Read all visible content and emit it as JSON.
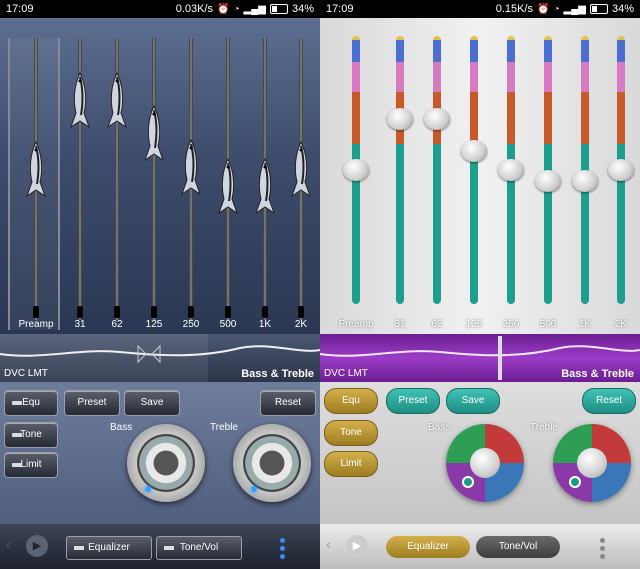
{
  "left": {
    "statusbar": {
      "time": "17:09",
      "speed": "0.03K/s",
      "battery": "34%"
    },
    "eq": {
      "labels": [
        "Preamp",
        "31",
        "62",
        "125",
        "250",
        "500",
        "1K",
        "2K"
      ],
      "levels": [
        0.58,
        0.28,
        0.28,
        0.42,
        0.57,
        0.65,
        0.65,
        0.58
      ]
    },
    "wave": {
      "left_label": "DVC LMT",
      "right_label": "Bass & Treble"
    },
    "buttons": {
      "equ": "Equ",
      "tone": "Tone",
      "limit": "Limit",
      "preset": "Preset",
      "save": "Save",
      "reset": "Reset"
    },
    "knobs": {
      "bass": "Bass",
      "treble": "Treble"
    },
    "bottom": {
      "equalizer": "Equalizer",
      "tonevol": "Tone/Vol"
    }
  },
  "right": {
    "statusbar": {
      "time": "17:09",
      "speed": "0.15K/s",
      "battery": "34%"
    },
    "eq": {
      "labels": [
        "Preamp",
        "31",
        "62",
        "125",
        "250",
        "500",
        "1K",
        "2K"
      ],
      "levels": [
        0.5,
        0.31,
        0.31,
        0.43,
        0.5,
        0.54,
        0.54,
        0.5
      ]
    },
    "wave": {
      "left_label": "DVC LMT",
      "right_label": "Bass & Treble"
    },
    "buttons": {
      "equ": "Equ",
      "tone": "Tone",
      "limit": "Limit",
      "preset": "Preset",
      "save": "Save",
      "reset": "Reset"
    },
    "knobs": {
      "bass": "Bass",
      "treble": "Treble"
    },
    "bottom": {
      "equalizer": "Equalizer",
      "tonevol": "Tone/Vol"
    }
  },
  "colors": {
    "teal": "#1e9e8f",
    "gold": "#c9a23b",
    "purple": "#8a2fb8",
    "blue_led": "#3aa0ff"
  }
}
